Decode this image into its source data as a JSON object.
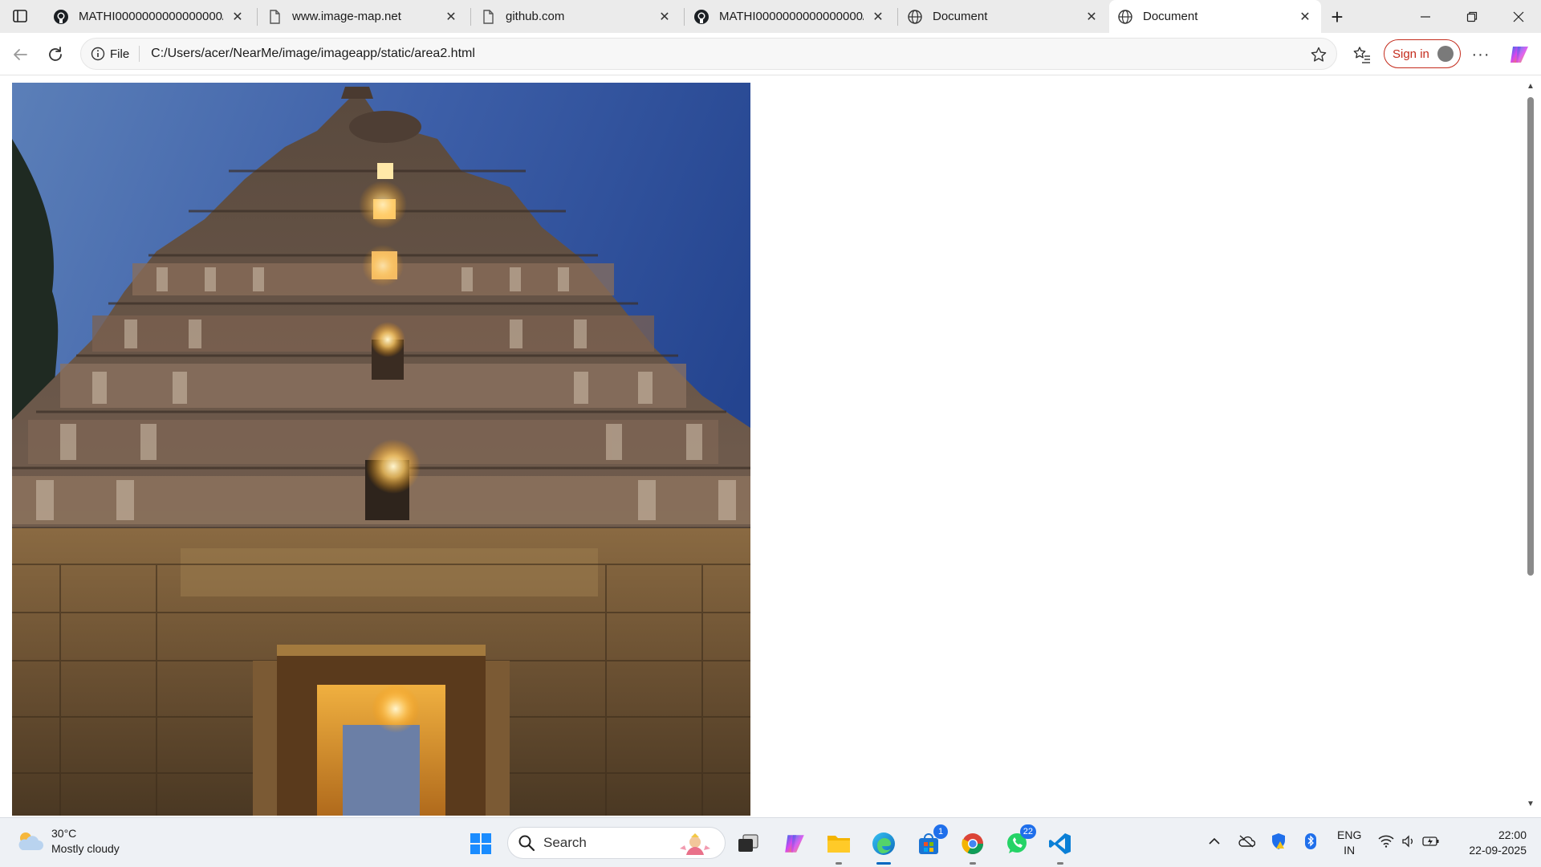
{
  "browser": {
    "tabs": [
      {
        "title": "MATHI0000000000000000/Nea",
        "icon": "github-icon",
        "active": false
      },
      {
        "title": "www.image-map.net",
        "icon": "page-icon",
        "active": false
      },
      {
        "title": "github.com",
        "icon": "page-icon",
        "active": false
      },
      {
        "title": "MATHI0000000000000000/Nea",
        "icon": "github-icon",
        "active": false
      },
      {
        "title": "Document",
        "icon": "globe-icon",
        "active": false
      },
      {
        "title": "Document",
        "icon": "globe-icon",
        "active": true
      }
    ],
    "address": {
      "scheme_label": "File",
      "url": "C:/Users/acer/NearMe/image/imageapp/static/area2.html"
    },
    "signin_label": "Sign in"
  },
  "page": {
    "image_subject": "temple gopuram photo"
  },
  "taskbar": {
    "weather": {
      "temp": "30°C",
      "condition": "Mostly cloudy"
    },
    "search_label": "Search",
    "store_badge": "1",
    "whatsapp_badge": "22",
    "language": {
      "line1": "ENG",
      "line2": "IN"
    },
    "clock": {
      "time": "22:00",
      "date": "22-09-2025"
    }
  },
  "colors": {
    "accent": "#0067c0",
    "signin_red": "#c42b1c",
    "badge_blue": "#1f6feb"
  }
}
